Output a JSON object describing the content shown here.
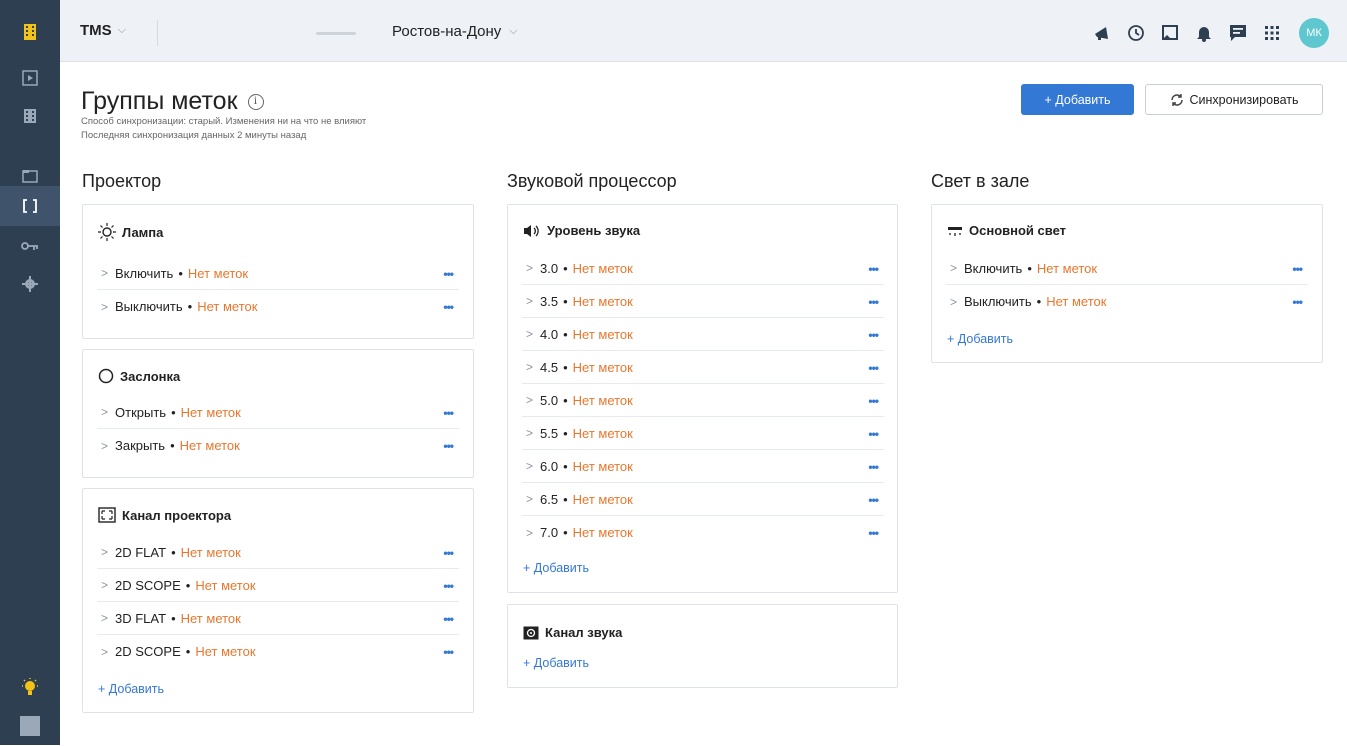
{
  "topbar": {
    "app_label": "TMS",
    "city": "Ростов-на-Дону",
    "avatar_initials": "МК"
  },
  "page": {
    "title": "Группы меток",
    "sync_method": "Способ синхронизации: старый. Изменения ни на что не влияют",
    "last_sync": "Последняя синхронизация данных 2 минуты назад",
    "add_button": "+ Добавить",
    "sync_button": "Синхронизировать"
  },
  "columns": [
    {
      "title": "Проектор",
      "cards": [
        {
          "name": "Лампа",
          "icon": "lamp-icon",
          "rows": [
            {
              "label": "Включить",
              "status": "Нет меток"
            },
            {
              "label": "Выключить",
              "status": "Нет меток"
            }
          ]
        },
        {
          "name": "Заслонка",
          "icon": "circle-icon",
          "rows": [
            {
              "label": "Открыть",
              "status": "Нет меток"
            },
            {
              "label": "Закрыть",
              "status": "Нет меток"
            }
          ]
        },
        {
          "name": "Канал проектора",
          "icon": "frame-icon",
          "rows": [
            {
              "label": "2D FLAT",
              "status": "Нет меток"
            },
            {
              "label": "2D SCOPE",
              "status": "Нет меток"
            },
            {
              "label": "3D FLAT",
              "status": "Нет меток"
            },
            {
              "label": "2D SCOPE",
              "status": "Нет меток"
            }
          ],
          "add_label": "+ Добавить"
        }
      ]
    },
    {
      "title": "Звуковой процессор",
      "cards": [
        {
          "name": "Уровень звука",
          "icon": "speaker-icon",
          "rows": [
            {
              "label": "3.0",
              "status": "Нет меток"
            },
            {
              "label": "3.5",
              "status": "Нет меток"
            },
            {
              "label": "4.0",
              "status": "Нет меток"
            },
            {
              "label": "4.5",
              "status": "Нет меток"
            },
            {
              "label": "5.0",
              "status": "Нет меток"
            },
            {
              "label": "5.5",
              "status": "Нет меток"
            },
            {
              "label": "6.0",
              "status": "Нет меток"
            },
            {
              "label": "6.5",
              "status": "Нет меток"
            },
            {
              "label": "7.0",
              "status": "Нет меток"
            }
          ],
          "add_label": "+ Добавить"
        },
        {
          "name": "Канал звука",
          "icon": "sound-channel-icon",
          "rows": [],
          "add_label": "+ Добавить"
        }
      ]
    },
    {
      "title": "Свет в зале",
      "cards": [
        {
          "name": "Основной свет",
          "icon": "ceiling-light-icon",
          "rows": [
            {
              "label": "Включить",
              "status": "Нет меток"
            },
            {
              "label": "Выключить",
              "status": "Нет меток"
            }
          ],
          "add_label": "+ Добавить"
        }
      ]
    }
  ],
  "colors": {
    "accent": "#3478d6",
    "status_orange": "#e8772e",
    "rail_bg": "#2f3f52"
  }
}
